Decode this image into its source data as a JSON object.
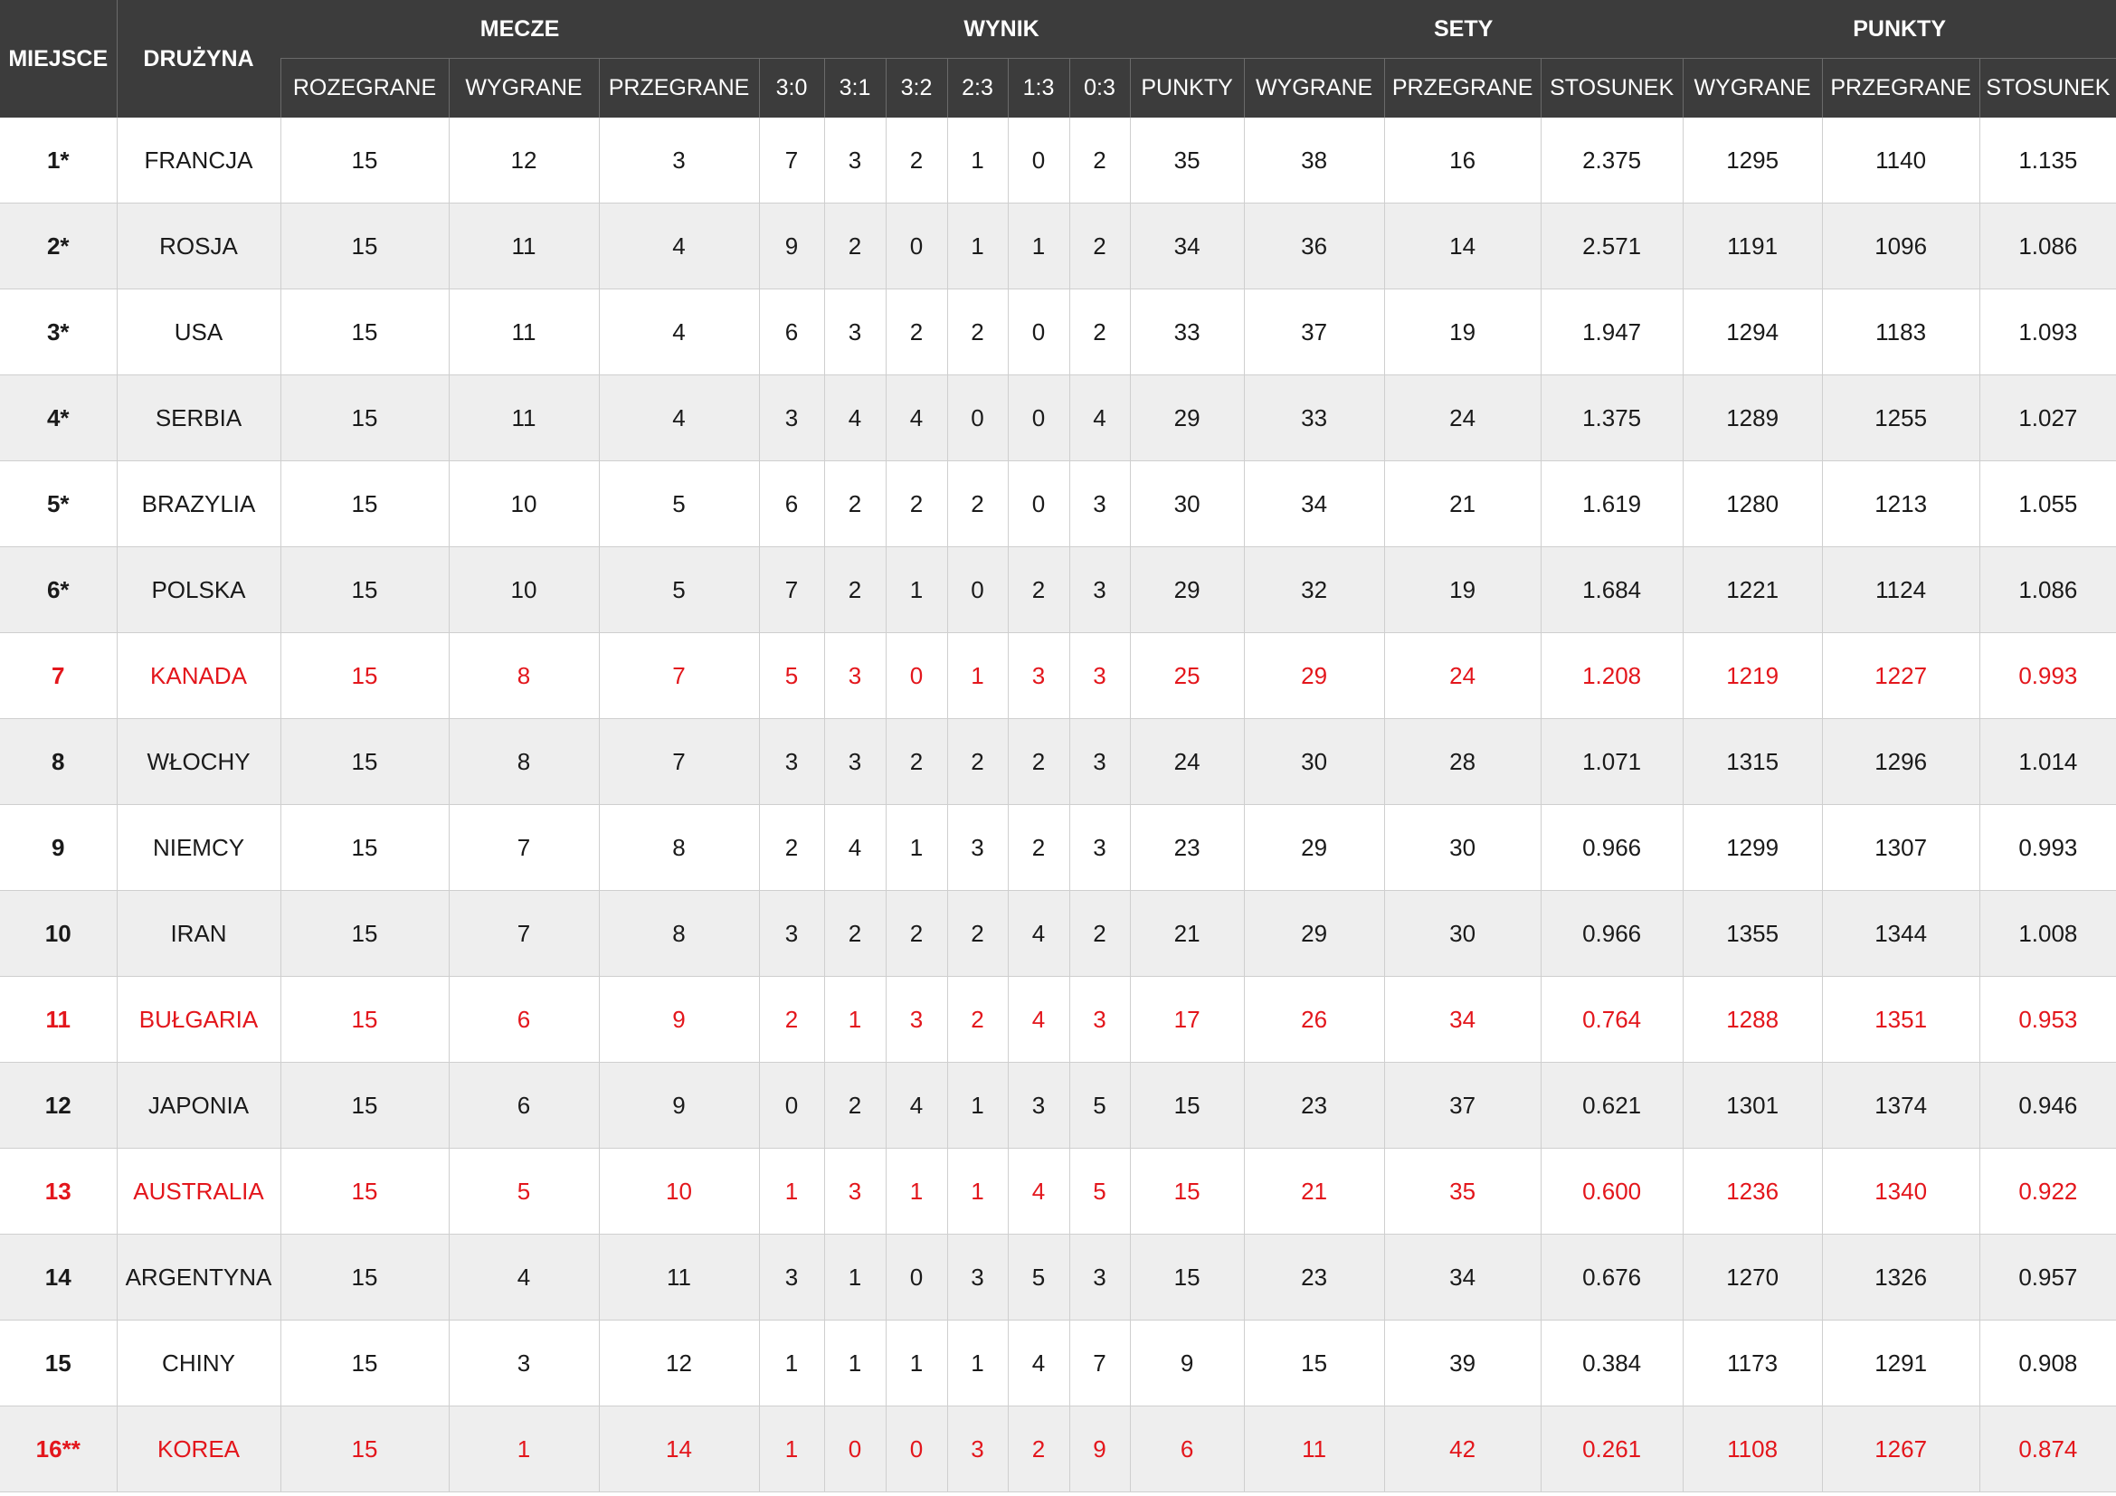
{
  "header": {
    "miejsce": "MIEJSCE",
    "druzyna": "DRUŻYNA",
    "groups": {
      "mecze": "MECZE",
      "wynik": "WYNIK",
      "sety": "SETY",
      "punkty": "PUNKTY"
    },
    "sub": {
      "rozegrane": "ROZEGRANE",
      "wygrane": "WYGRANE",
      "przegrane": "PRZEGRANE",
      "r30": "3:0",
      "r31": "3:1",
      "r32": "3:2",
      "r23": "2:3",
      "r13": "1:3",
      "r03": "0:3",
      "punkty": "PUNKTY",
      "sety_wygrane": "WYGRANE",
      "sety_przegrane": "PRZEGRANE",
      "sety_stosunek": "STOSUNEK",
      "pkt_wygrane": "WYGRANE",
      "pkt_przegrane": "PRZEGRANE",
      "pkt_stosunek": "STOSUNEK"
    }
  },
  "colors": {
    "header_bg": "#3c3c3c",
    "highlight_red": "#e3161c",
    "row_alt": "#eeeeee"
  },
  "rows": [
    {
      "highlight": false,
      "cells": [
        "1*",
        "FRANCJA",
        "15",
        "12",
        "3",
        "7",
        "3",
        "2",
        "1",
        "0",
        "2",
        "35",
        "38",
        "16",
        "2.375",
        "1295",
        "1140",
        "1.135"
      ]
    },
    {
      "highlight": false,
      "cells": [
        "2*",
        "ROSJA",
        "15",
        "11",
        "4",
        "9",
        "2",
        "0",
        "1",
        "1",
        "2",
        "34",
        "36",
        "14",
        "2.571",
        "1191",
        "1096",
        "1.086"
      ]
    },
    {
      "highlight": false,
      "cells": [
        "3*",
        "USA",
        "15",
        "11",
        "4",
        "6",
        "3",
        "2",
        "2",
        "0",
        "2",
        "33",
        "37",
        "19",
        "1.947",
        "1294",
        "1183",
        "1.093"
      ]
    },
    {
      "highlight": false,
      "cells": [
        "4*",
        "SERBIA",
        "15",
        "11",
        "4",
        "3",
        "4",
        "4",
        "0",
        "0",
        "4",
        "29",
        "33",
        "24",
        "1.375",
        "1289",
        "1255",
        "1.027"
      ]
    },
    {
      "highlight": false,
      "cells": [
        "5*",
        "BRAZYLIA",
        "15",
        "10",
        "5",
        "6",
        "2",
        "2",
        "2",
        "0",
        "3",
        "30",
        "34",
        "21",
        "1.619",
        "1280",
        "1213",
        "1.055"
      ]
    },
    {
      "highlight": false,
      "cells": [
        "6*",
        "POLSKA",
        "15",
        "10",
        "5",
        "7",
        "2",
        "1",
        "0",
        "2",
        "3",
        "29",
        "32",
        "19",
        "1.684",
        "1221",
        "1124",
        "1.086"
      ]
    },
    {
      "highlight": true,
      "cells": [
        "7",
        "KANADA",
        "15",
        "8",
        "7",
        "5",
        "3",
        "0",
        "1",
        "3",
        "3",
        "25",
        "29",
        "24",
        "1.208",
        "1219",
        "1227",
        "0.993"
      ]
    },
    {
      "highlight": false,
      "cells": [
        "8",
        "WŁOCHY",
        "15",
        "8",
        "7",
        "3",
        "3",
        "2",
        "2",
        "2",
        "3",
        "24",
        "30",
        "28",
        "1.071",
        "1315",
        "1296",
        "1.014"
      ]
    },
    {
      "highlight": false,
      "cells": [
        "9",
        "NIEMCY",
        "15",
        "7",
        "8",
        "2",
        "4",
        "1",
        "3",
        "2",
        "3",
        "23",
        "29",
        "30",
        "0.966",
        "1299",
        "1307",
        "0.993"
      ]
    },
    {
      "highlight": false,
      "cells": [
        "10",
        "IRAN",
        "15",
        "7",
        "8",
        "3",
        "2",
        "2",
        "2",
        "4",
        "2",
        "21",
        "29",
        "30",
        "0.966",
        "1355",
        "1344",
        "1.008"
      ]
    },
    {
      "highlight": true,
      "cells": [
        "11",
        "BUŁGARIA",
        "15",
        "6",
        "9",
        "2",
        "1",
        "3",
        "2",
        "4",
        "3",
        "17",
        "26",
        "34",
        "0.764",
        "1288",
        "1351",
        "0.953"
      ]
    },
    {
      "highlight": false,
      "cells": [
        "12",
        "JAPONIA",
        "15",
        "6",
        "9",
        "0",
        "2",
        "4",
        "1",
        "3",
        "5",
        "15",
        "23",
        "37",
        "0.621",
        "1301",
        "1374",
        "0.946"
      ]
    },
    {
      "highlight": true,
      "cells": [
        "13",
        "AUSTRALIA",
        "15",
        "5",
        "10",
        "1",
        "3",
        "1",
        "1",
        "4",
        "5",
        "15",
        "21",
        "35",
        "0.600",
        "1236",
        "1340",
        "0.922"
      ]
    },
    {
      "highlight": false,
      "cells": [
        "14",
        "ARGENTYNA",
        "15",
        "4",
        "11",
        "3",
        "1",
        "0",
        "3",
        "5",
        "3",
        "15",
        "23",
        "34",
        "0.676",
        "1270",
        "1326",
        "0.957"
      ]
    },
    {
      "highlight": false,
      "cells": [
        "15",
        "CHINY",
        "15",
        "3",
        "12",
        "1",
        "1",
        "1",
        "1",
        "4",
        "7",
        "9",
        "15",
        "39",
        "0.384",
        "1173",
        "1291",
        "0.908"
      ]
    },
    {
      "highlight": true,
      "cells": [
        "16**",
        "KOREA",
        "15",
        "1",
        "14",
        "1",
        "0",
        "0",
        "3",
        "2",
        "9",
        "6",
        "11",
        "42",
        "0.261",
        "1108",
        "1267",
        "0.874"
      ]
    }
  ]
}
